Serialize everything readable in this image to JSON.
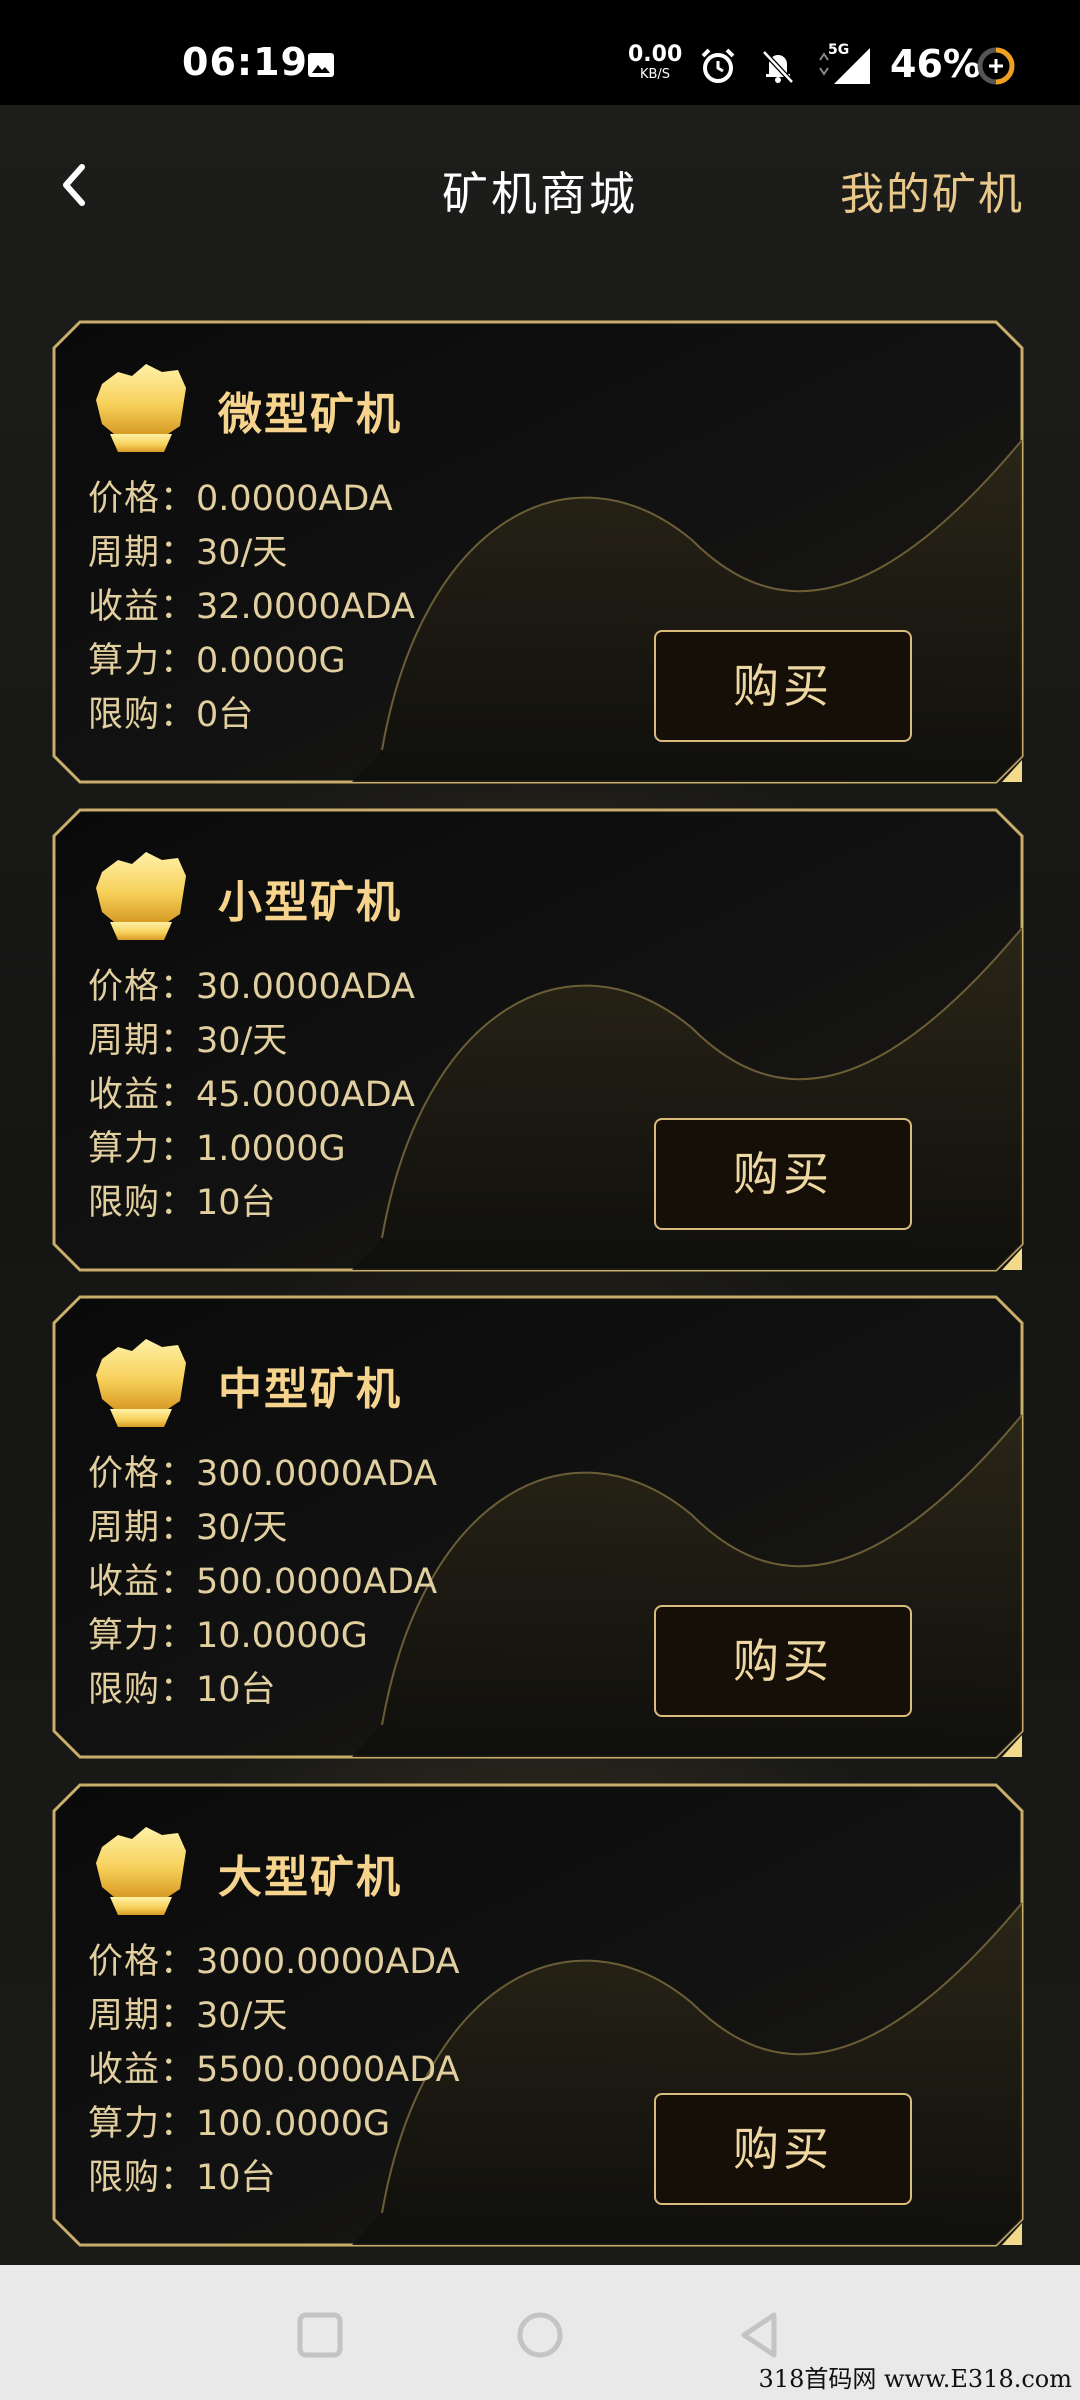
{
  "status_bar": {
    "time": "06:19",
    "net_speed": "0.00",
    "net_unit": "KB/S",
    "signal_label": "5G",
    "battery": "46%",
    "icons": [
      "image-icon",
      "alarm-icon",
      "bell-off-icon",
      "signal-icon",
      "battery-icon"
    ]
  },
  "header": {
    "back_icon": "chevron-left-icon",
    "title": "矿机商城",
    "my_miners": "我的矿机"
  },
  "theme": {
    "gold": "#f6d48e",
    "text_gold": "#e2cf9f",
    "link_gold": "#e9c98a",
    "background": "#141414"
  },
  "labels": {
    "price": "价格：",
    "cycle": "周期：",
    "income": "收益：",
    "hashrate": "算力：",
    "limit": "限购：",
    "buy": "购买"
  },
  "miners": [
    {
      "name": "微型矿机",
      "price": "0.0000ADA",
      "cycle": "30/天",
      "income": "32.0000ADA",
      "hashrate": "0.0000G",
      "limit": "0台"
    },
    {
      "name": "小型矿机",
      "price": "30.0000ADA",
      "cycle": "30/天",
      "income": "45.0000ADA",
      "hashrate": "1.0000G",
      "limit": "10台"
    },
    {
      "name": "中型矿机",
      "price": "300.0000ADA",
      "cycle": "30/天",
      "income": "500.0000ADA",
      "hashrate": "10.0000G",
      "limit": "10台"
    },
    {
      "name": "大型矿机",
      "price": "3000.0000ADA",
      "cycle": "30/天",
      "income": "5500.0000ADA",
      "hashrate": "100.0000G",
      "limit": "10台"
    }
  ],
  "nav_bar": {
    "icons": [
      "recent-apps-icon",
      "home-icon",
      "back-triangle-icon"
    ]
  },
  "watermark": "318首码网 www.E318.com"
}
